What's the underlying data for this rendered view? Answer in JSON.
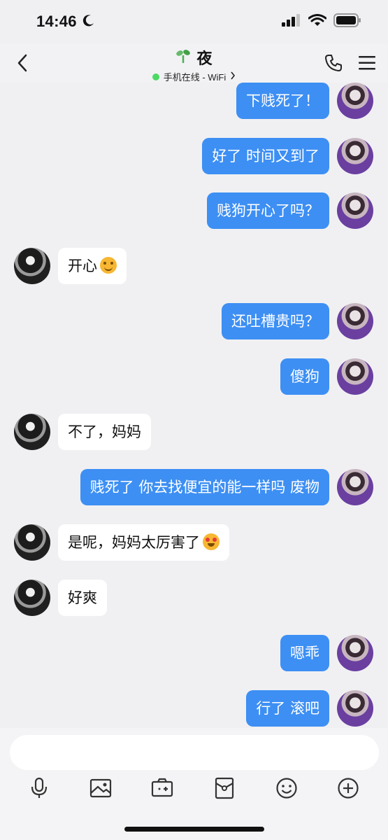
{
  "status": {
    "time": "14:46"
  },
  "header": {
    "title": "夜",
    "subtitle": "手机在线 - WiFi"
  },
  "messages": [
    {
      "side": "out",
      "text": "下贱死了！"
    },
    {
      "side": "out",
      "text": "好了 时间又到了"
    },
    {
      "side": "out",
      "text": "贱狗开心了吗？"
    },
    {
      "side": "in",
      "text": "开心",
      "emoji": "smiling-face"
    },
    {
      "side": "out",
      "text": "还吐槽贵吗？"
    },
    {
      "side": "out",
      "text": "傻狗"
    },
    {
      "side": "in",
      "text": "不了，妈妈"
    },
    {
      "side": "out",
      "text": "贱死了 你去找便宜的能一样吗 废物"
    },
    {
      "side": "in",
      "text": "是呢，妈妈太厉害了",
      "emoji": "heart-eyes"
    },
    {
      "side": "in",
      "text": "好爽"
    },
    {
      "side": "out",
      "text": "嗯乖"
    },
    {
      "side": "out",
      "text": "行了 滚吧"
    }
  ],
  "input": {
    "value": "",
    "placeholder": ""
  },
  "toolbar": [
    "microphone-icon",
    "image-icon",
    "camera-icon",
    "red-packet-icon",
    "emoji-icon",
    "plus-icon"
  ],
  "colors": {
    "outgoing_bubble": "#3d8ff3",
    "incoming_bubble": "#ffffff",
    "background": "#f0f0f3",
    "online": "#4cd964"
  }
}
